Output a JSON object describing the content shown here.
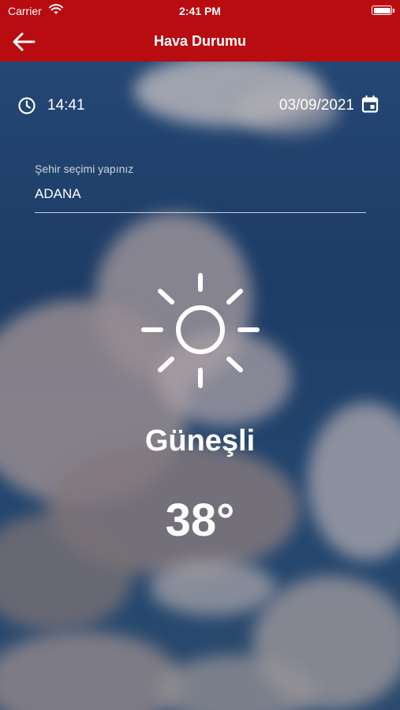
{
  "status_bar": {
    "carrier": "Carrier",
    "time": "2:41 PM"
  },
  "nav": {
    "title": "Hava Durumu",
    "back_icon": "arrow-left-icon"
  },
  "info": {
    "time": "14:41",
    "date": "03/09/2021",
    "clock_icon": "clock-icon",
    "calendar_icon": "calendar-icon"
  },
  "city": {
    "placeholder": "Şehir seçimi yapınız",
    "value": "ADANA"
  },
  "weather": {
    "icon": "sun-icon",
    "condition": "Güneşli",
    "temperature": "38°"
  },
  "colors": {
    "header": "#b80c10",
    "text": "#ffffff"
  }
}
